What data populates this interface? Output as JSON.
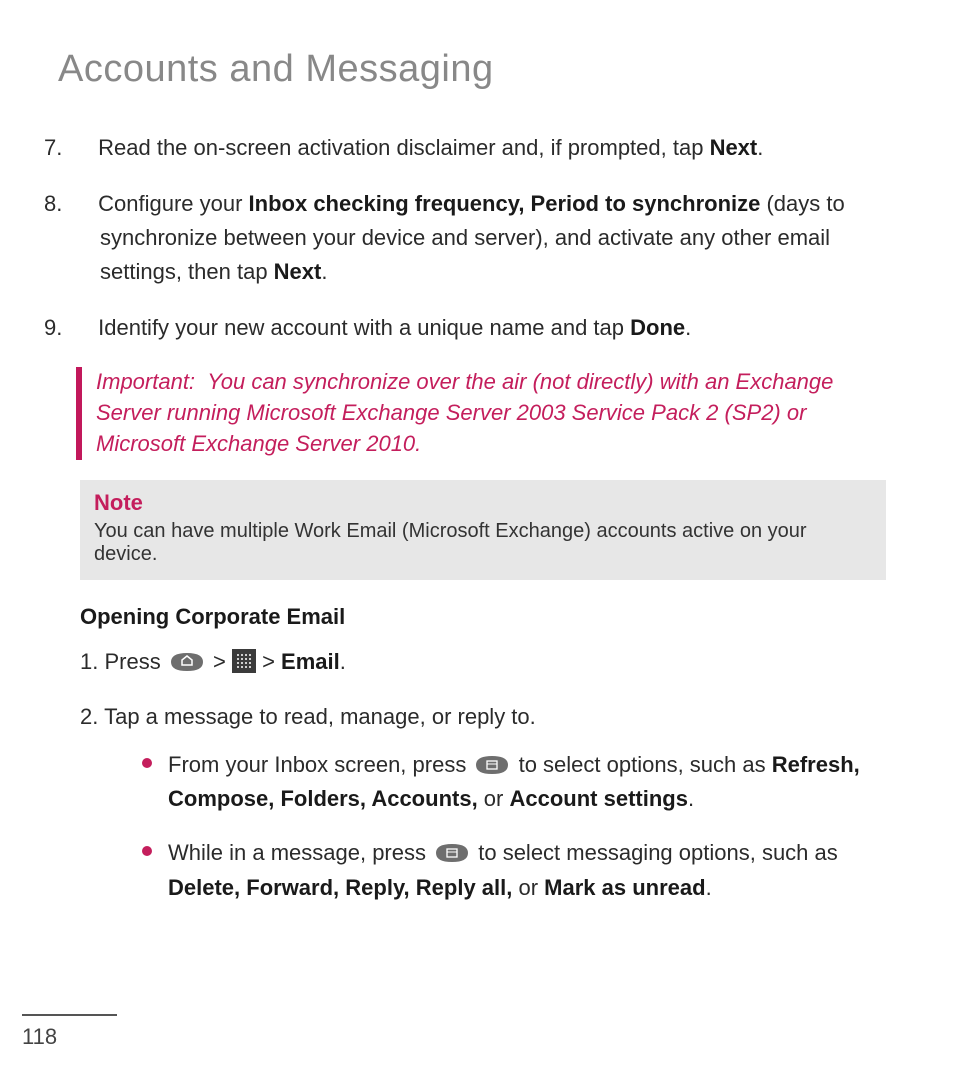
{
  "title": "Accounts and Messaging",
  "steps_a": {
    "7": {
      "num": "7.",
      "pre": "Read the on-screen activation disclaimer and, if prompted, tap ",
      "bold": "Next",
      "post": "."
    },
    "8": {
      "num": "8.",
      "pre": "Configure your ",
      "bold": "Inbox checking frequency, Period to synchronize ",
      "mid": "(days to synchronize between your device and server), and activate any other email settings, then tap ",
      "bold2": "Next",
      "post": "."
    },
    "9": {
      "num": "9.",
      "pre": "Identify your new account with a unique name and tap ",
      "bold": "Done",
      "post": "."
    }
  },
  "important": {
    "label": "Important:",
    "text": "You can synchronize over the air (not directly) with an Exchange Server running Microsoft Exchange Server 2003 Service Pack 2 (SP2) or Microsoft Exchange Server 2010."
  },
  "note": {
    "title": "Note",
    "body": "You can have multiple Work Email (Microsoft Exchange) accounts active on your device."
  },
  "subhead": "Opening Corporate Email",
  "steps_b": {
    "1": {
      "num": "1.",
      "pre": "Press ",
      "sep1": "  >  ",
      "sep2": " > ",
      "bold": "Email",
      "post": "."
    },
    "2": {
      "num": "2.",
      "text": "Tap a message to read, manage, or reply to."
    }
  },
  "bullets": {
    "0": {
      "pre": "From your Inbox screen, press ",
      "mid": " to select options, such as ",
      "bold": "Refresh, Compose, Folders, Accounts,",
      "or": " or ",
      "bold2": "Account settings",
      "post": "."
    },
    "1": {
      "pre": "While in a message, press ",
      "mid": " to select messaging options, such as ",
      "bold": "Delete, Forward, Reply, Reply all,",
      "or": " or ",
      "bold2": "Mark as unread",
      "post": "."
    }
  },
  "icons": {
    "home_key": "home-key-icon",
    "apps_grid": "apps-grid-icon",
    "menu_key": "menu-key-icon"
  },
  "page_number": "118"
}
